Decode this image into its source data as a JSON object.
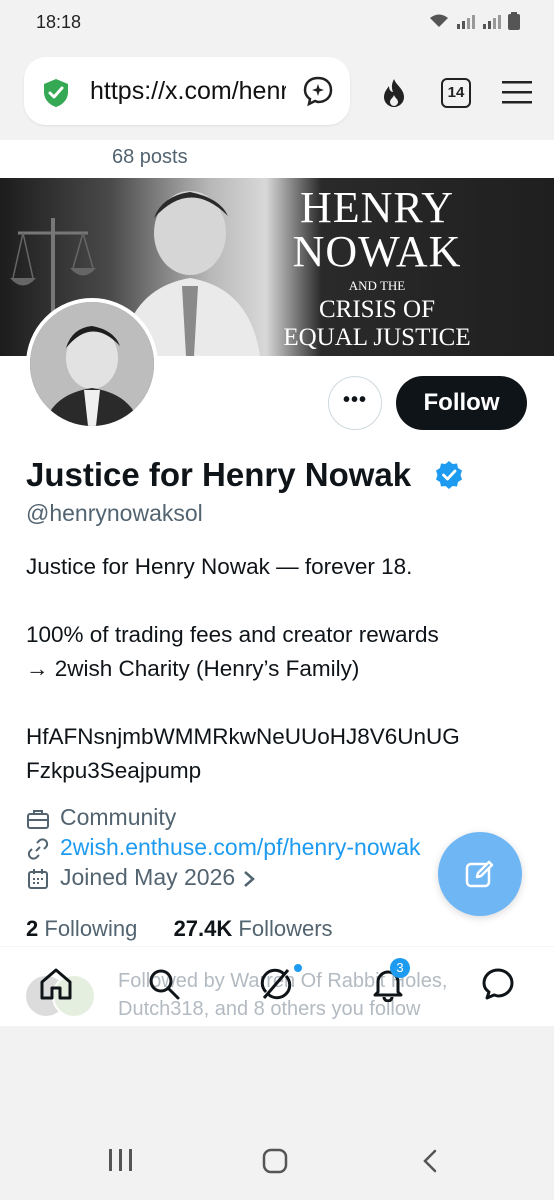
{
  "status_bar": {
    "time": "18:18"
  },
  "browser": {
    "url": "https://x.com/henrynowaksol",
    "tab_count": "14"
  },
  "profile": {
    "posts_count": "68 posts",
    "banner": {
      "line1": "HENRY",
      "line2": "NOWAK",
      "line3": "AND THE",
      "line4": "CRISIS OF",
      "line5": "EQUAL JUSTICE"
    },
    "name": "Justice for Henry Nowak",
    "handle": "@henrynowaksol",
    "bio": {
      "line1": "Justice for Henry Nowak — forever 18.",
      "line2": "100% of trading fees and creator rewards",
      "line3": "→ 2wish Charity (Henry’s Family)",
      "line4": "HfAFNsnjmbWMMRkwNeUUoHJ8V6UnUG",
      "line5": "Fzkpu3Seajpump"
    },
    "category": "Community",
    "link": "2wish.enthuse.com/pf/henry-nowak",
    "joined": "Joined May 2026",
    "following_count": "2",
    "following_label": "Following",
    "followers_count": "27.4K",
    "followers_label": "Followers",
    "followed_by_line1": "Followed by Warren Of Rabbit Holes,",
    "followed_by_line2": "Dutch318, and 8 others you follow"
  },
  "buttons": {
    "follow": "Follow",
    "more": "•••"
  },
  "tabbar": {
    "notifications_badge": "3"
  },
  "colors": {
    "accent": "#1d9bf0",
    "follow_bg": "#0f1419",
    "fab": "#6fb6f5"
  }
}
